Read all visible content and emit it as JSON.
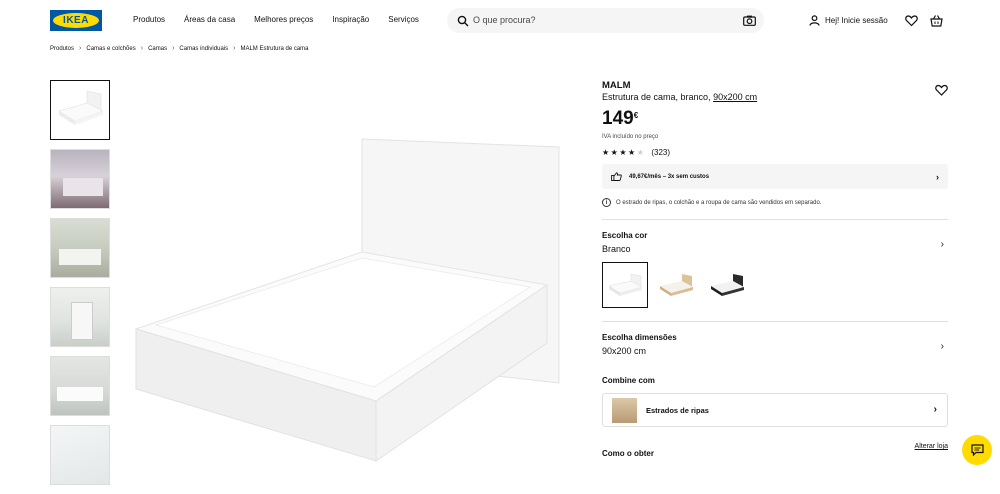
{
  "brand": {
    "logo_text": "IKEA",
    "blue": "#0058a3",
    "yellow": "#ffdb00"
  },
  "nav": [
    "Produtos",
    "Áreas da casa",
    "Melhores preços",
    "Inspiração",
    "Serviços"
  ],
  "search": {
    "placeholder": "O que procura?"
  },
  "account": {
    "label": "Hej! Inicie sessão"
  },
  "breadcrumb": [
    "Produtos",
    "Camas e colchões",
    "Camas",
    "Camas individuais",
    "MALM Estrutura de cama"
  ],
  "product": {
    "name": "MALM",
    "description": "Estrutura de cama, branco,",
    "size_link": "90x200 cm",
    "price": "149",
    "currency": "€",
    "vat_note": "IVA incluído no preço",
    "rating": 3.5,
    "reviews": "(323)",
    "financing": "49,67€/mês – 3x sem custos",
    "info_note": "O estrado de ripas, o colchão e a roupa de cama são vendidos em separado."
  },
  "color_section": {
    "title": "Escolha cor",
    "value": "Branco"
  },
  "size_section": {
    "title": "Escolha dimensões",
    "value": "90x200 cm"
  },
  "combine": {
    "title": "Combine com",
    "item": "Estrados de ripas"
  },
  "get": {
    "title": "Como o obter",
    "link": "Alterar loja"
  }
}
